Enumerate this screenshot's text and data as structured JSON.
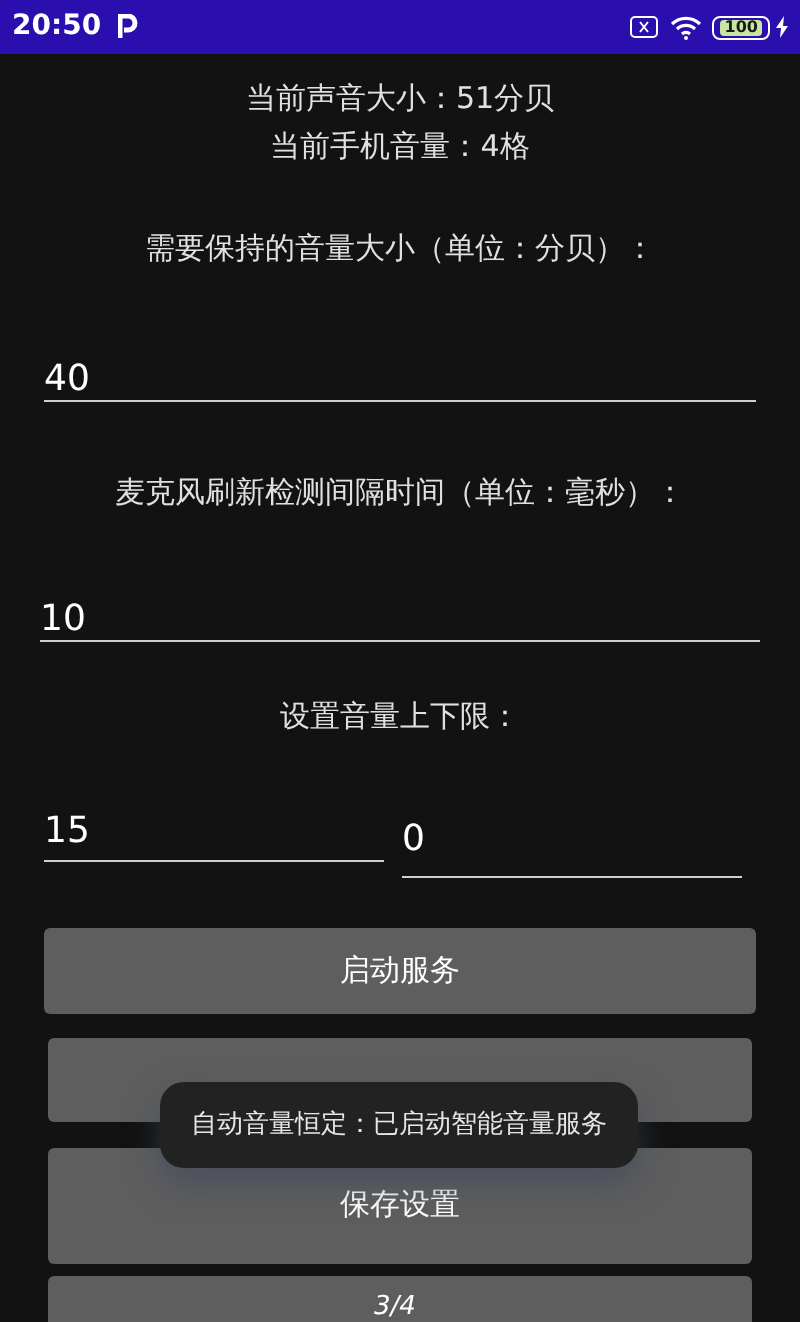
{
  "status_bar": {
    "time": "20:50",
    "battery": "100"
  },
  "info": [
    "当前声音大小：51分贝",
    "当前手机音量：4格"
  ],
  "target_volume": {
    "label": "需要保持的音量大小（单位：分贝）：",
    "value": "40"
  },
  "interval": {
    "label": "麦克风刷新检测间隔时间（单位：毫秒）：",
    "value": "10"
  },
  "limits": {
    "label": "设置音量上下限：",
    "upper": "15",
    "lower": "0"
  },
  "buttons": [
    {
      "kind": "labeled",
      "label": "启动服务"
    },
    {
      "kind": "covered"
    },
    {
      "kind": "labeled",
      "label": "保存设置"
    },
    {
      "kind": "covered"
    }
  ],
  "page_indicator": "3/4",
  "toast": "自动音量恒定：已启动智能音量服务"
}
